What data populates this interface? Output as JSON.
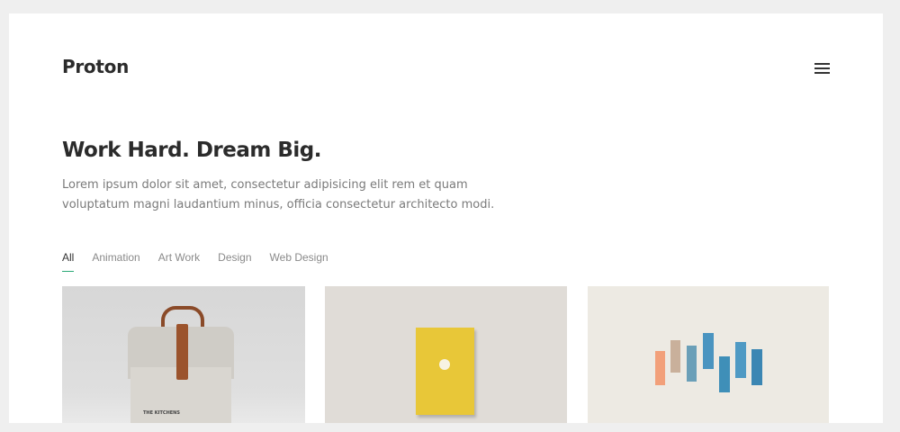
{
  "header": {
    "brand": "Proton",
    "menu_icon": "hamburger-menu-icon"
  },
  "hero": {
    "title": "Work Hard. Dream Big.",
    "text": "Lorem ipsum dolor sit amet, consectetur adipisicing elit rem et quam voluptatum magni laudantium minus, officia consectetur architecto modi."
  },
  "filters": {
    "active": "All",
    "items": [
      "All",
      "Animation",
      "Art Work",
      "Design",
      "Web Design"
    ]
  },
  "portfolio": {
    "tile1_label": "THE KITCHENS",
    "colors": {
      "accent": "#2aa876",
      "bag": "#d9d6d0",
      "leather": "#9b532c",
      "book": "#e8c738",
      "strip_orange": "#f2a07a",
      "strip_blue": "#3f8fb8"
    }
  }
}
